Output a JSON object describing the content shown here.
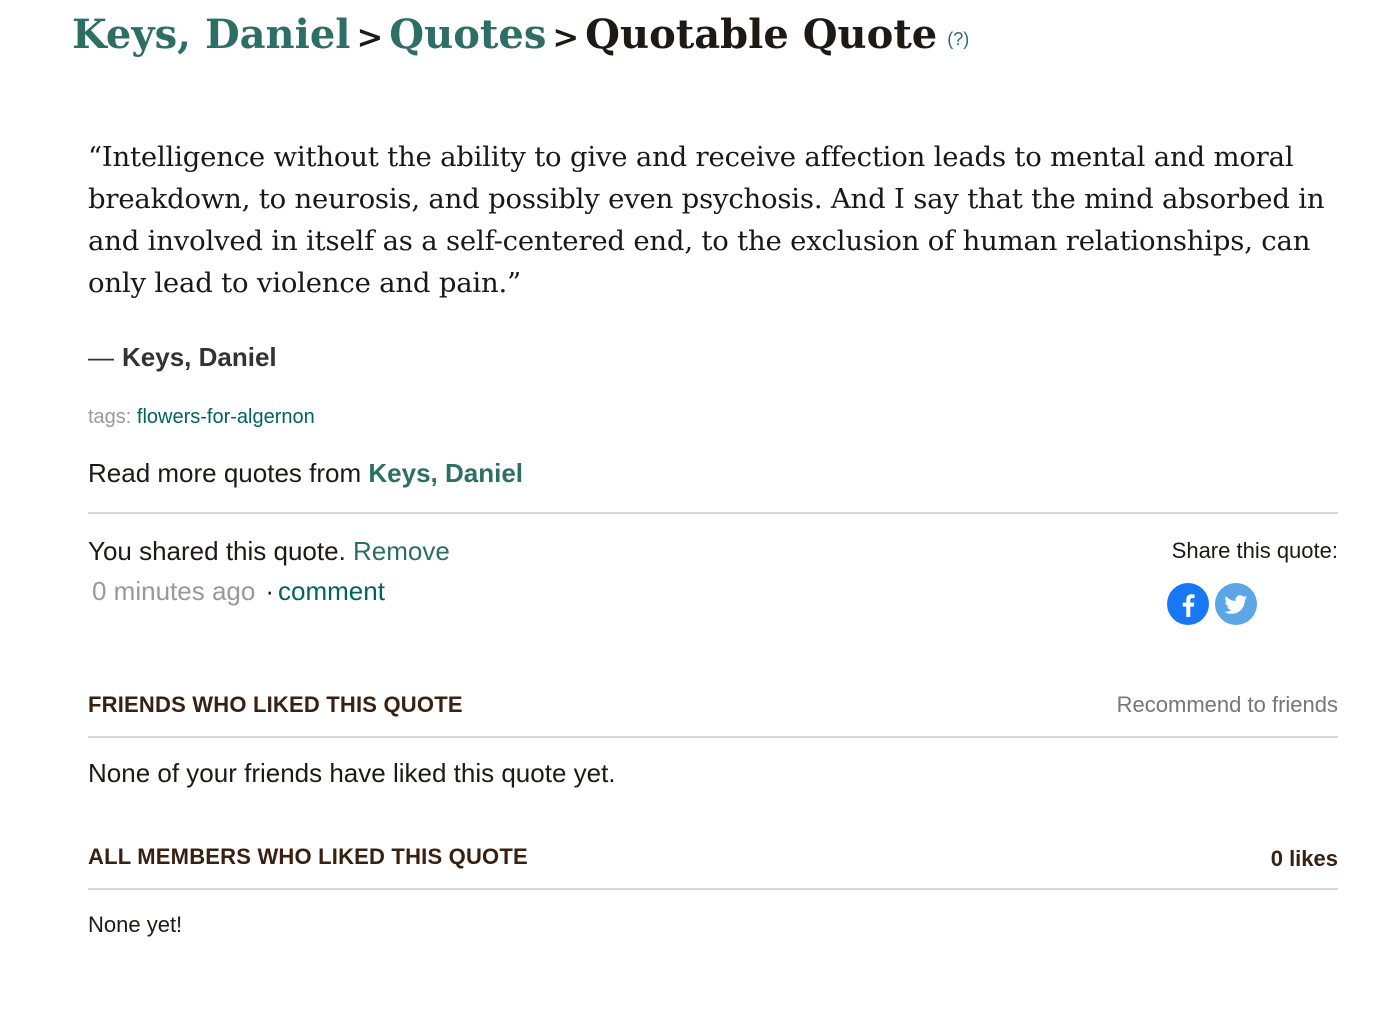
{
  "breadcrumb": {
    "author": "Keys, Daniel",
    "section": "Quotes",
    "current": "Quotable Quote",
    "help": "(?)"
  },
  "quote": {
    "text": "“Intelligence without the ability to give and receive affection leads to mental and moral breakdown, to neurosis, and possibly even psychosis. And I say that the mind absorbed in and involved in itself as a self-centered end, to the exclusion of human relationships, can only lead to violence and pain.”",
    "dash": "―",
    "author": "Keys, Daniel"
  },
  "tags": {
    "label": "tags:",
    "items": [
      "flowers-for-algernon"
    ]
  },
  "read_more": {
    "prefix": "Read more quotes from",
    "author": "Keys, Daniel"
  },
  "shared": {
    "text": "You shared this quote.",
    "remove_label": "Remove",
    "time": "0 minutes ago",
    "dot": "·",
    "comment_label": "comment"
  },
  "share": {
    "label": "Share this quote:",
    "icons": [
      "facebook-icon",
      "twitter-icon"
    ],
    "colors": {
      "facebook": "#1877f2",
      "twitter": "#5aa6e6"
    }
  },
  "friends_section": {
    "title": "FRIENDS WHO LIKED THIS QUOTE",
    "action": "Recommend to friends",
    "empty": "None of your friends have liked this quote yet."
  },
  "members_section": {
    "title": "ALL MEMBERS WHO LIKED THIS QUOTE",
    "count": "0 likes",
    "empty": "None yet!"
  },
  "colors": {
    "link": "#00635d",
    "heading_link": "#2d6e65",
    "section_title": "#382110",
    "muted": "#999999"
  }
}
